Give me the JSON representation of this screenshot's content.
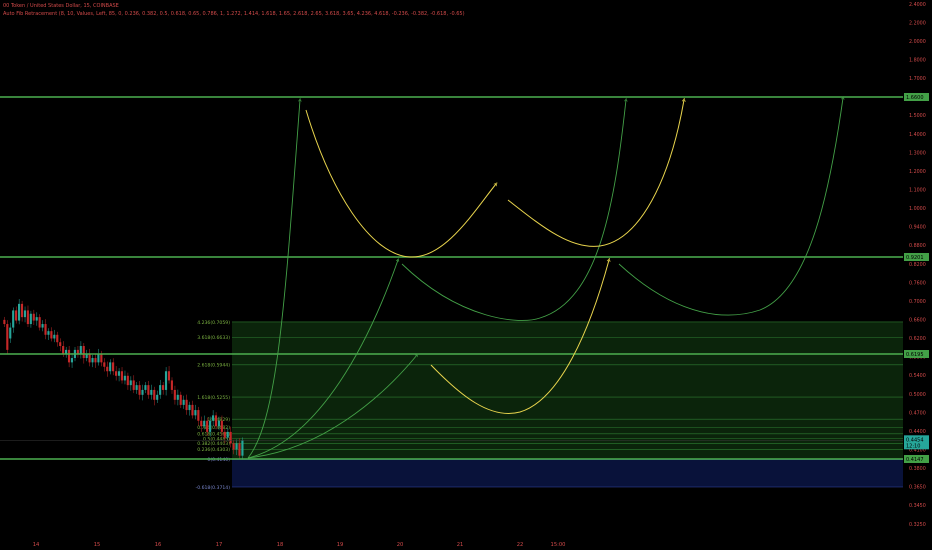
{
  "header": {
    "symbol_line": "00 Token / United States Dollar, 15, COINBASE",
    "indicator_line": "Auto Fib Retracement (8, 10, Values, Left, 85, 0, 0.236, 0.382, 0.5, 0.618, 0.65, 0.786, 1, 1.272, 1.414, 1.618, 1.65, 2.618, 2.65, 3.618, 3.65, 4.236, 4.618, -0.236, -0.382, -0.618, -0.65)"
  },
  "colors": {
    "background": "#000000",
    "level_line": "#4caf50",
    "fib_line": "#2e7d32",
    "fib_fill": "#0d2a0d",
    "neg_fill": "#0a1440",
    "arrow_green": "#43a047",
    "arrow_yellow": "#e8d44d",
    "candle_up": "#26a69a",
    "candle_down": "#c62828",
    "axis_text": "#d24a4a"
  },
  "chart_data": {
    "type": "candlestick",
    "x_axis": {
      "tick_labels": [
        "14",
        "15",
        "16",
        "17",
        "18",
        "19",
        "20",
        "21",
        "22",
        "15:00"
      ]
    },
    "y_axis": {
      "scale": "log",
      "range": [
        0.32,
        2.4
      ],
      "tick_labels": [
        "2.4000",
        "2.2000",
        "2.0000",
        "1.8000",
        "1.7000",
        "1.6000",
        "1.5000",
        "1.4000",
        "1.3000",
        "1.2000",
        "1.1000",
        "1.0000",
        "0.9400",
        "0.8800",
        "0.8200",
        "0.7600",
        "0.7000",
        "0.6600",
        "0.6200",
        "0.5800",
        "0.5400",
        "0.5000",
        "0.4700",
        "0.4400",
        "0.4100",
        "0.3800",
        "0.3650",
        "0.3450",
        "0.3250"
      ]
    },
    "price_levels": [
      {
        "label": "1.6600",
        "value": 1.66
      },
      {
        "label": "0.9201",
        "value": 0.9201
      },
      {
        "label": "0.6195",
        "value": 0.6195
      },
      {
        "label": "0.4147",
        "value": 0.4147
      }
    ],
    "current_price": {
      "label": "0.4454",
      "value": 0.4454,
      "countdown": "12:10"
    },
    "fib_levels": [
      {
        "label": "4.236(0.7059)",
        "value": 0.7059
      },
      {
        "label": "3.618(0.6633)",
        "value": 0.6633
      },
      {
        "label": "2.618(0.5944)",
        "value": 0.5944
      },
      {
        "label": "1.618(0.5255)",
        "value": 0.5255
      },
      {
        "label": "1(0.4829)",
        "value": 0.4829
      },
      {
        "label": "0.786(0.4682)",
        "value": 0.4682
      },
      {
        "label": "0.618(0.4566)",
        "value": 0.4566
      },
      {
        "label": "0.5(0.4485)",
        "value": 0.4485
      },
      {
        "label": "0.382(0.4403)",
        "value": 0.4403
      },
      {
        "label": "0.236(0.4303)",
        "value": 0.4303
      },
      {
        "label": "0(0.4140)",
        "value": 0.414
      },
      {
        "label": "-0.618(0.3714)",
        "value": 0.3714
      }
    ],
    "candles": [
      [
        0,
        0.712,
        0.7
      ],
      [
        1,
        0.7,
        0.63
      ],
      [
        2,
        0.66,
        0.69
      ],
      [
        3,
        0.69,
        0.74
      ],
      [
        4,
        0.74,
        0.71
      ],
      [
        5,
        0.71,
        0.76
      ],
      [
        6,
        0.76,
        0.72
      ],
      [
        7,
        0.72,
        0.74
      ],
      [
        8,
        0.74,
        0.7
      ],
      [
        9,
        0.7,
        0.73
      ],
      [
        10,
        0.73,
        0.71
      ],
      [
        11,
        0.71,
        0.72
      ],
      [
        12,
        0.72,
        0.69
      ],
      [
        13,
        0.69,
        0.7
      ],
      [
        14,
        0.7,
        0.67
      ],
      [
        15,
        0.67,
        0.68
      ],
      [
        16,
        0.68,
        0.66
      ],
      [
        17,
        0.66,
        0.67
      ],
      [
        18,
        0.67,
        0.65
      ],
      [
        19,
        0.65,
        0.64
      ],
      [
        20,
        0.64,
        0.62
      ],
      [
        21,
        0.62,
        0.63
      ],
      [
        22,
        0.63,
        0.6
      ],
      [
        23,
        0.6,
        0.61
      ],
      [
        24,
        0.61,
        0.63
      ],
      [
        25,
        0.63,
        0.62
      ],
      [
        26,
        0.62,
        0.64
      ],
      [
        27,
        0.64,
        0.61
      ],
      [
        28,
        0.61,
        0.62
      ],
      [
        29,
        0.62,
        0.6
      ],
      [
        30,
        0.6,
        0.61
      ],
      [
        31,
        0.61,
        0.6
      ],
      [
        32,
        0.6,
        0.62
      ],
      [
        33,
        0.62,
        0.6
      ],
      [
        34,
        0.6,
        0.59
      ],
      [
        35,
        0.59,
        0.58
      ],
      [
        36,
        0.58,
        0.6
      ],
      [
        37,
        0.6,
        0.58
      ],
      [
        38,
        0.58,
        0.57
      ],
      [
        39,
        0.57,
        0.58
      ],
      [
        40,
        0.58,
        0.56
      ],
      [
        41,
        0.56,
        0.57
      ],
      [
        42,
        0.57,
        0.55
      ],
      [
        43,
        0.55,
        0.56
      ],
      [
        44,
        0.56,
        0.54
      ],
      [
        45,
        0.54,
        0.55
      ],
      [
        46,
        0.55,
        0.53
      ],
      [
        47,
        0.53,
        0.54
      ],
      [
        48,
        0.54,
        0.55
      ],
      [
        49,
        0.55,
        0.53
      ],
      [
        50,
        0.53,
        0.54
      ],
      [
        51,
        0.54,
        0.52
      ],
      [
        52,
        0.52,
        0.53
      ],
      [
        53,
        0.53,
        0.55
      ],
      [
        54,
        0.55,
        0.54
      ],
      [
        55,
        0.54,
        0.58
      ],
      [
        56,
        0.58,
        0.56
      ],
      [
        57,
        0.56,
        0.54
      ],
      [
        58,
        0.54,
        0.52
      ],
      [
        59,
        0.52,
        0.53
      ],
      [
        60,
        0.53,
        0.51
      ],
      [
        61,
        0.51,
        0.52
      ],
      [
        62,
        0.52,
        0.5
      ],
      [
        63,
        0.5,
        0.51
      ],
      [
        64,
        0.51,
        0.49
      ],
      [
        65,
        0.49,
        0.5
      ],
      [
        66,
        0.5,
        0.48
      ],
      [
        67,
        0.48,
        0.47
      ],
      [
        68,
        0.47,
        0.48
      ],
      [
        69,
        0.48,
        0.46
      ],
      [
        70,
        0.46,
        0.48
      ],
      [
        71,
        0.48,
        0.49
      ],
      [
        72,
        0.49,
        0.47
      ],
      [
        73,
        0.47,
        0.48
      ],
      [
        74,
        0.48,
        0.46
      ],
      [
        75,
        0.46,
        0.45
      ],
      [
        76,
        0.45,
        0.46
      ],
      [
        77,
        0.46,
        0.44
      ],
      [
        78,
        0.44,
        0.43
      ],
      [
        79,
        0.43,
        0.44
      ],
      [
        80,
        0.44,
        0.42
      ],
      [
        81,
        0.42,
        0.445
      ]
    ]
  }
}
